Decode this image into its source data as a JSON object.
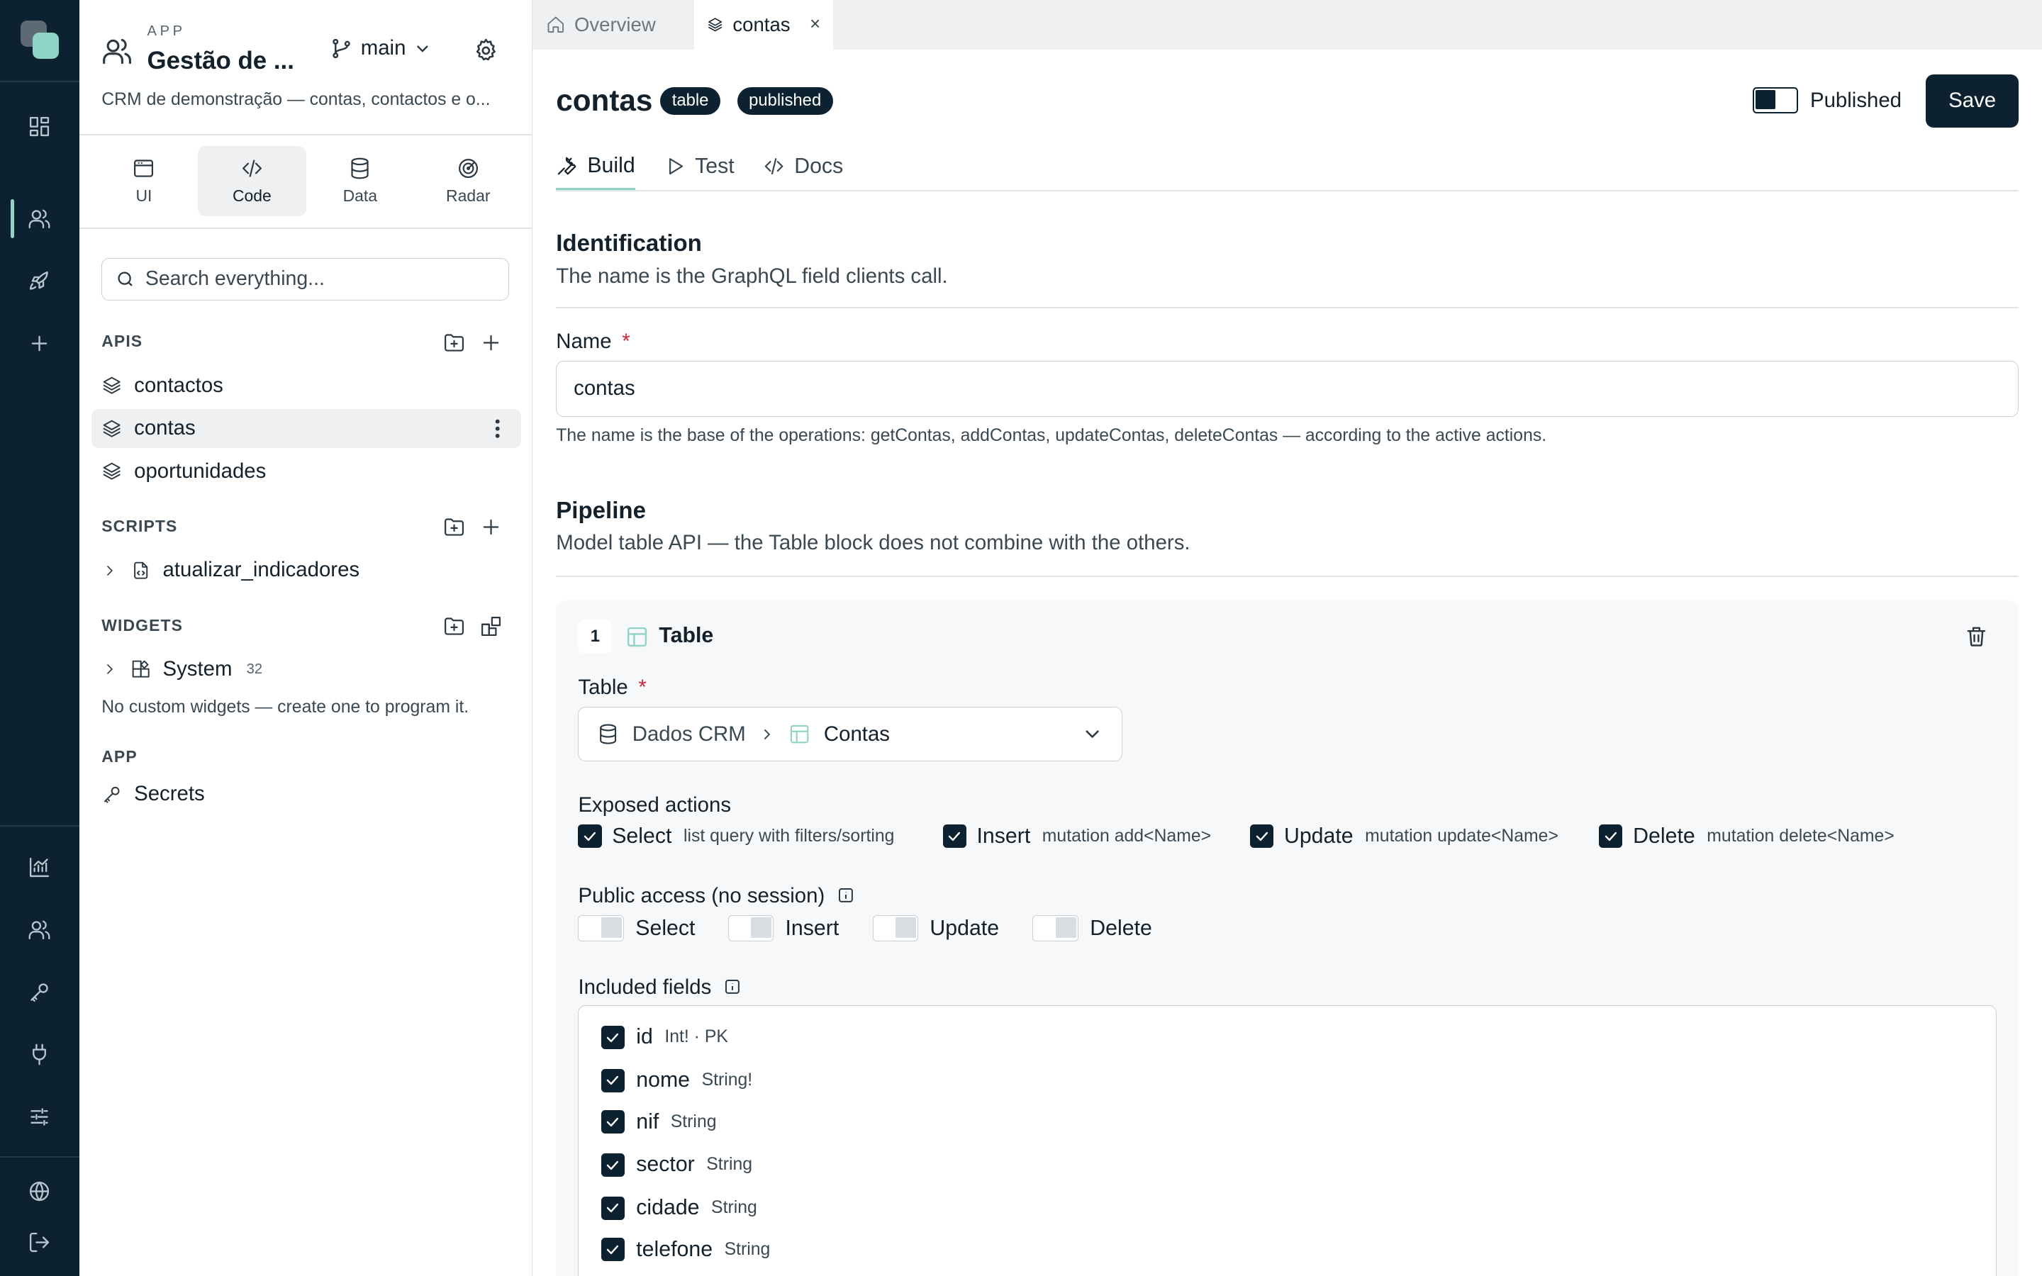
{
  "app": {
    "eyebrow": "APP",
    "title": "Gestão de ...",
    "branch": "main",
    "description": "CRM de demonstração — contas, contactos e o..."
  },
  "modes": [
    {
      "label": "UI",
      "icon": "window-icon"
    },
    {
      "label": "Code",
      "icon": "code-icon"
    },
    {
      "label": "Data",
      "icon": "database-icon"
    },
    {
      "label": "Radar",
      "icon": "radar-icon"
    }
  ],
  "search": {
    "placeholder": "Search everything..."
  },
  "sections": {
    "apis": {
      "title": "APIS",
      "items": [
        "contactos",
        "contas",
        "oportunidades"
      ]
    },
    "scripts": {
      "title": "SCRIPTS",
      "items": [
        "atualizar_indicadores"
      ]
    },
    "widgets": {
      "title": "WIDGETS",
      "items": [
        {
          "label": "System",
          "count": "32"
        }
      ],
      "note": "No custom widgets — create one to program it."
    },
    "app": {
      "title": "APP",
      "items": [
        "Secrets"
      ]
    }
  },
  "tabs": [
    {
      "label": "Overview",
      "icon": "home-icon"
    },
    {
      "label": "contas",
      "icon": "layers-icon",
      "close": "×"
    }
  ],
  "page": {
    "title": "contas",
    "badges": [
      "table",
      "published"
    ],
    "published_label": "Published",
    "save_label": "Save",
    "subtabs": [
      "Build",
      "Test",
      "Docs"
    ]
  },
  "identification": {
    "heading": "Identification",
    "description": "The name is the GraphQL field clients call.",
    "name_label": "Name",
    "required_mark": "*",
    "name_value": "contas",
    "help": "The name is the base of the operations: getContas, addContas, updateContas, deleteContas — according to the active actions."
  },
  "pipeline": {
    "heading": "Pipeline",
    "description": "Model table API — the Table block does not combine with the others.",
    "block": {
      "step": "1",
      "title": "Table",
      "table_label": "Table",
      "source": "Dados CRM",
      "separator": ">",
      "table": "Contas",
      "exposed_actions_label": "Exposed actions",
      "actions": [
        {
          "name": "Select",
          "desc": "list query with filters/sorting"
        },
        {
          "name": "Insert",
          "desc": "mutation add<Name>"
        },
        {
          "name": "Update",
          "desc": "mutation update<Name>"
        },
        {
          "name": "Delete",
          "desc": "mutation delete<Name>"
        }
      ],
      "public_access_label": "Public access (no session)",
      "public_access": [
        "Select",
        "Insert",
        "Update",
        "Delete"
      ],
      "included_fields_label": "Included fields",
      "fields": [
        {
          "name": "id",
          "type": "Int! · PK"
        },
        {
          "name": "nome",
          "type": "String!"
        },
        {
          "name": "nif",
          "type": "String"
        },
        {
          "name": "sector",
          "type": "String"
        },
        {
          "name": "cidade",
          "type": "String"
        },
        {
          "name": "telefone",
          "type": "String"
        }
      ]
    }
  },
  "colors": {
    "rail": "#0d2230",
    "accent": "#8fd3c4",
    "required": "#d0283a"
  }
}
